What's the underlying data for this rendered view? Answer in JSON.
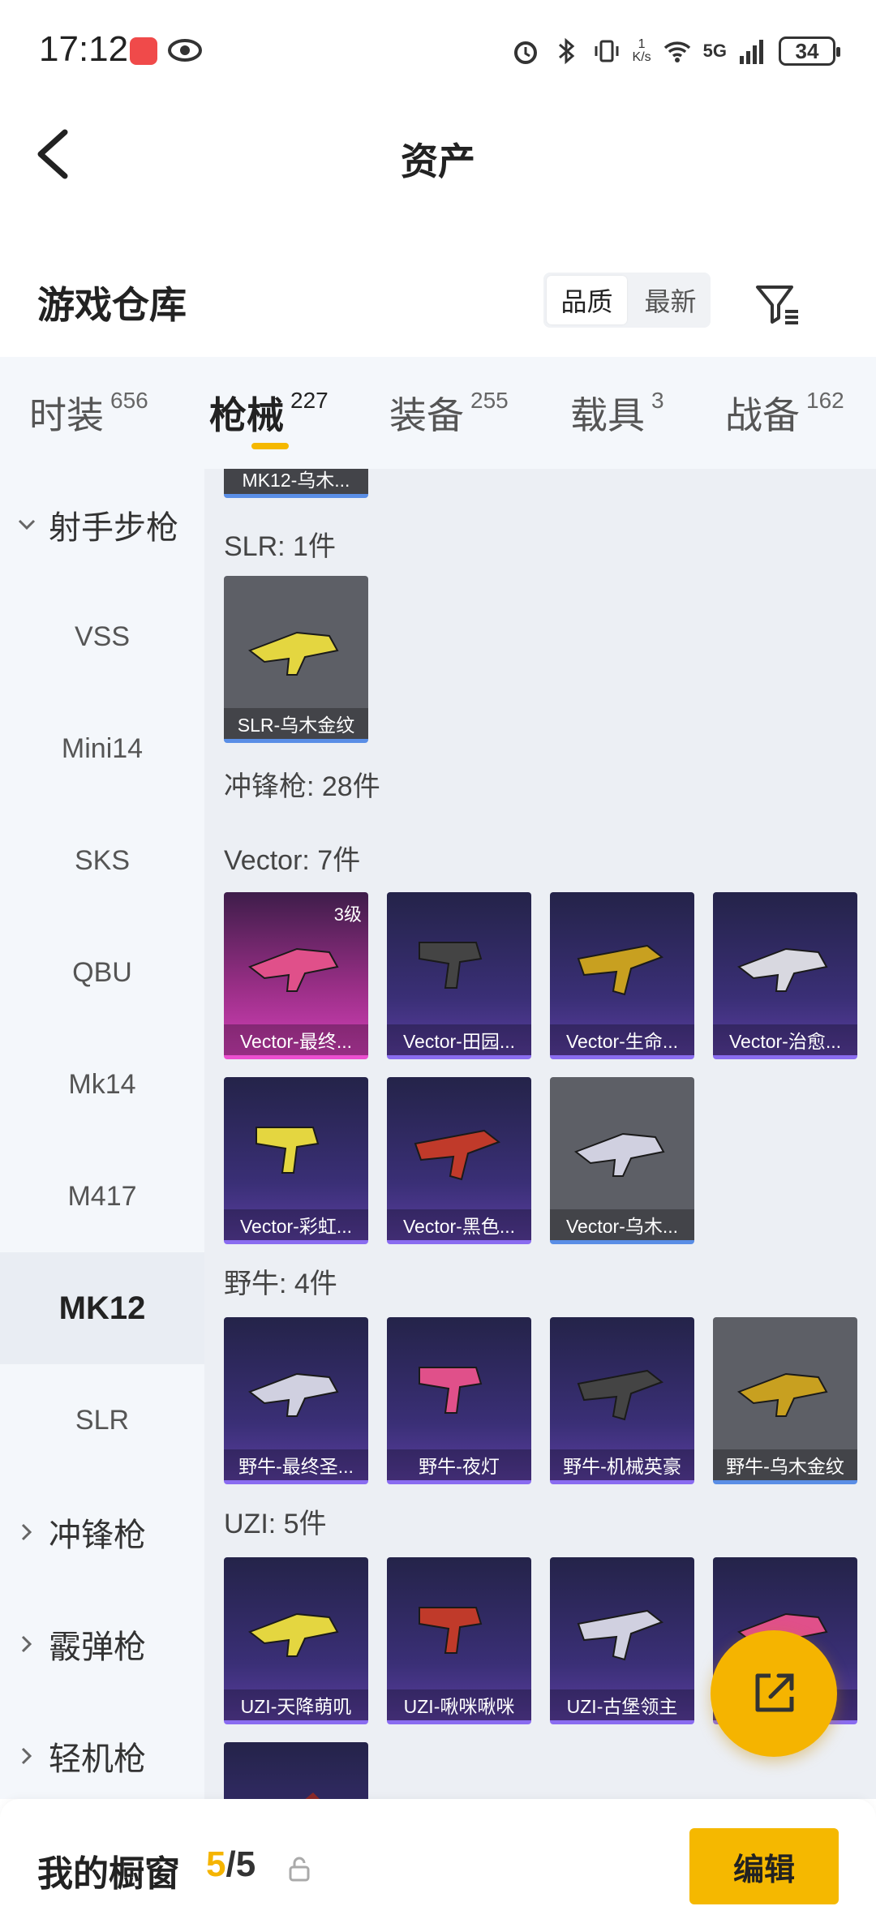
{
  "status_bar": {
    "time": "17:12",
    "net_speed_value": "1",
    "net_speed_unit": "K/s",
    "network": "5G",
    "battery": "34"
  },
  "header": {
    "title": "资产",
    "back_icon": "chevron-left-icon"
  },
  "section": {
    "title": "游戏仓库",
    "sort_options": [
      "品质",
      "最新"
    ],
    "sort_active": "品质",
    "filter_icon": "filter-icon"
  },
  "tabs": [
    {
      "label": "时装",
      "count": "656"
    },
    {
      "label": "枪械",
      "count": "227",
      "active": true
    },
    {
      "label": "装备",
      "count": "255"
    },
    {
      "label": "载具",
      "count": "3"
    },
    {
      "label": "战备",
      "count": "162"
    }
  ],
  "sidebar": {
    "group_open": "射手步枪",
    "items": [
      "VSS",
      "Mini14",
      "SKS",
      "QBU",
      "Mk14",
      "M417",
      "MK12",
      "SLR"
    ],
    "active_item": "MK12",
    "groups_closed": [
      "冲锋枪",
      "霰弹枪",
      "轻机枪"
    ]
  },
  "content": {
    "top_card": "MK12-乌木...",
    "slr_label": "SLR: 1件",
    "slr_cards": [
      {
        "name": "SLR-乌木金纹",
        "style": "gray"
      }
    ],
    "smg_label": "冲锋枪: 28件",
    "vector_label": "Vector: 7件",
    "vector_cards": [
      {
        "name": "Vector-最终...",
        "style": "pink",
        "badge": "3级"
      },
      {
        "name": "Vector-田园...",
        "style": "purple"
      },
      {
        "name": "Vector-生命...",
        "style": "purple"
      },
      {
        "name": "Vector-治愈...",
        "style": "purple"
      },
      {
        "name": "Vector-彩虹...",
        "style": "purple"
      },
      {
        "name": "Vector-黑色...",
        "style": "purple"
      },
      {
        "name": "Vector-乌木...",
        "style": "gray"
      }
    ],
    "bizon_label": "野牛: 4件",
    "bizon_cards": [
      {
        "name": "野牛-最终圣...",
        "style": "purple"
      },
      {
        "name": "野牛-夜灯",
        "style": "purple"
      },
      {
        "name": "野牛-机械英豪",
        "style": "purple"
      },
      {
        "name": "野牛-乌木金纹",
        "style": "gray"
      }
    ],
    "uzi_label": "UZI: 5件",
    "uzi_cards": [
      {
        "name": "UZI-天降萌叽",
        "style": "purple"
      },
      {
        "name": "UZI-啾咪啾咪",
        "style": "purple"
      },
      {
        "name": "UZI-古堡领主",
        "style": "purple"
      },
      {
        "name": "UZI-...器",
        "style": "purple"
      }
    ]
  },
  "fab": {
    "icon": "share-external-icon"
  },
  "bottom_bar": {
    "title": "我的橱窗",
    "current": "5",
    "total": "/5",
    "lock_icon": "lock-icon",
    "edit_label": "编辑"
  },
  "colors": {
    "accent": "#f5b800",
    "rare_purple": "#8a6cf0",
    "legendary_pink": "#ec4fd0",
    "basic_blue": "#5a8ee6"
  }
}
